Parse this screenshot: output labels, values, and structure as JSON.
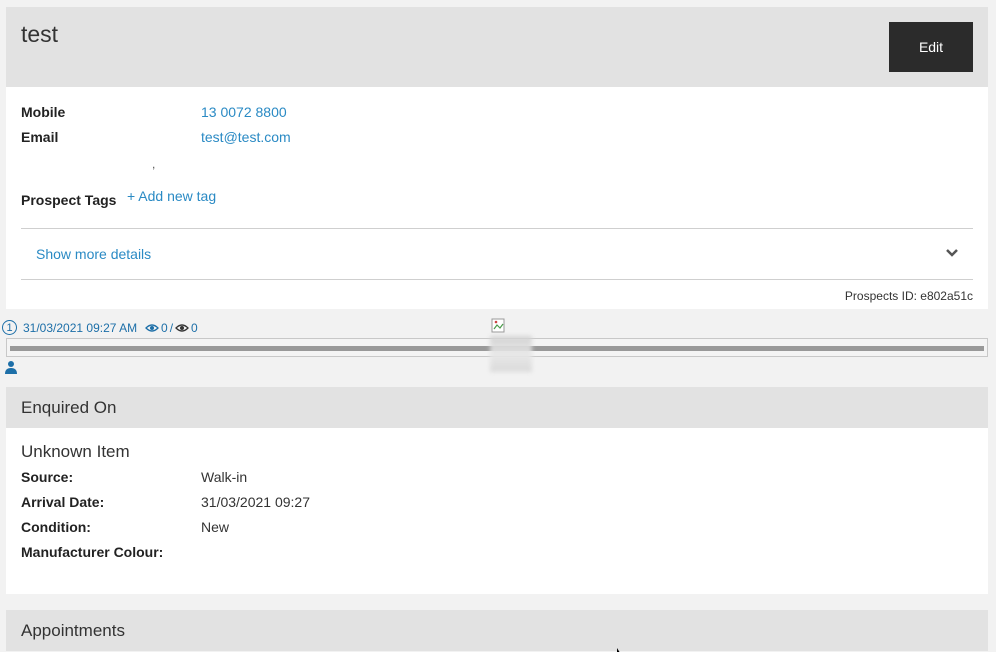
{
  "header": {
    "title": "test",
    "edit_label": "Edit"
  },
  "details": {
    "mobile_label": "Mobile",
    "mobile_value": "13 0072 8800",
    "email_label": "Email",
    "email_value": "test@test.com",
    "stray_comma": ",",
    "tags_label": "Prospect Tags",
    "add_tag_label": "+ Add new tag",
    "show_more_label": "Show more details",
    "prospect_id": "Prospects ID: e802a51c"
  },
  "timeline": {
    "event_number": "1",
    "event_date": "31/03/2021 09:27 AM",
    "views_a": "0",
    "views_sep": "/",
    "views_b": "0"
  },
  "enquired": {
    "section_title": "Enquired On",
    "item_title": "Unknown Item",
    "fields": [
      {
        "label": "Source:",
        "value": "Walk-in"
      },
      {
        "label": "Arrival Date:",
        "value": "31/03/2021 09:27"
      },
      {
        "label": "Condition:",
        "value": "New"
      },
      {
        "label": "Manufacturer Colour:",
        "value": ""
      }
    ]
  },
  "appointments": {
    "section_title": "Appointments"
  },
  "colors": {
    "link": "#2a8ac4",
    "timeline": "#1d6fa8",
    "header_bg": "#e2e2e2",
    "button_bg": "#2b2b2b"
  },
  "icons": [
    "chevron-down-icon",
    "eye-icon",
    "user-icon",
    "broken-image-icon",
    "cursor-icon"
  ]
}
